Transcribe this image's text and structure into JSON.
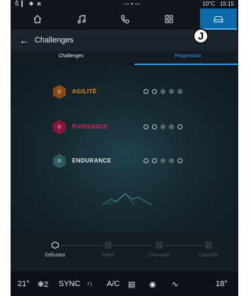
{
  "status_bar": {
    "left": "Š ▎ ✱ ≇",
    "center": "— • —",
    "temp": "10°C",
    "time": "15:15"
  },
  "nav": {
    "items": [
      "home-icon",
      "music-icon",
      "phone-icon",
      "apps-icon",
      "car-icon"
    ],
    "active": "car-icon"
  },
  "header": {
    "back": "←",
    "title": "Challenges"
  },
  "marker": "J",
  "tabs": {
    "challenges": "Challenges",
    "progression": "Progression",
    "active": "Progression"
  },
  "challenges": [
    {
      "name": "AGILITÉ",
      "level": "0",
      "color": "#f08a1c",
      "hex_color": "#8a4a10",
      "filled_dots": [
        3,
        4,
        5
      ]
    },
    {
      "name": "PUISSANCE",
      "level": "0",
      "color": "#e0285a",
      "hex_color": "#8a1738",
      "filled_dots": [
        3,
        4
      ]
    },
    {
      "name": "ENDURANCE",
      "level": "0",
      "color": "#e6edf2",
      "hex_color": "#2a5c60",
      "filled_dots": [
        3,
        4
      ]
    }
  ],
  "levels": {
    "items": [
      "Débutant",
      "Pilote",
      "Champion",
      "Légende"
    ],
    "active": "Débutant"
  },
  "climate": {
    "left_temp": "21°",
    "fan": "2",
    "sync": "SYNC",
    "ac": "A/C",
    "right_temp": "18°"
  }
}
